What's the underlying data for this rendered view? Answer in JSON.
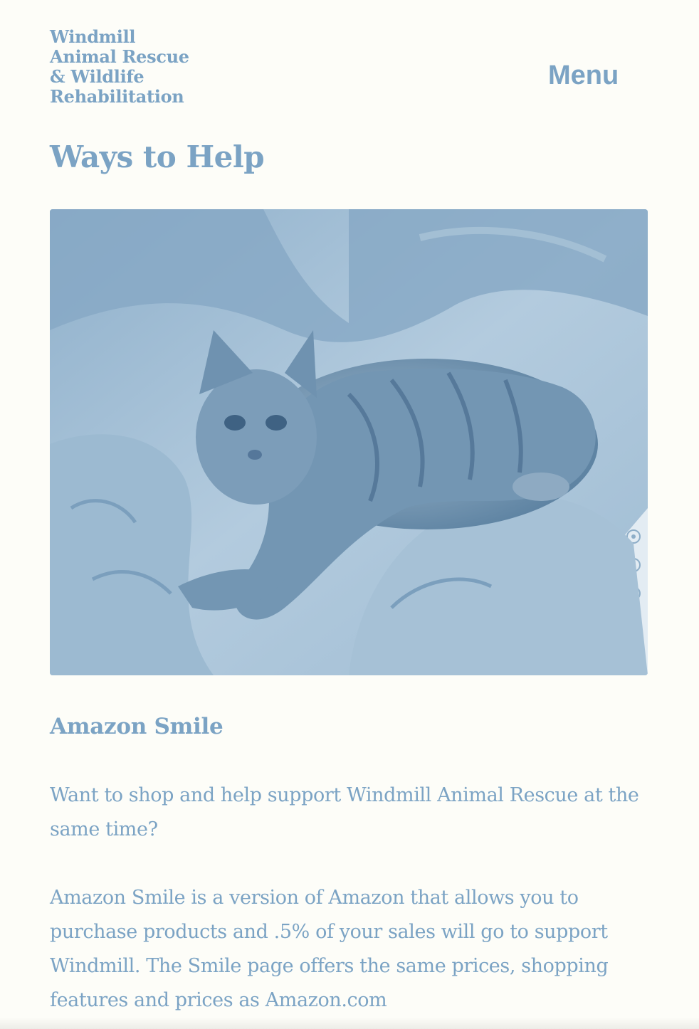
{
  "header": {
    "site_title_lines": [
      "Windmill",
      "Animal Rescue",
      "& Wildlife",
      "Rehabilitation"
    ],
    "menu_label": "Menu"
  },
  "page": {
    "title": "Ways to Help"
  },
  "hero": {
    "image_subject": "kitten-on-blanket"
  },
  "section": {
    "heading": "Amazon Smile",
    "paragraph_1": "Want to shop and help support Windmill Animal Rescue at the same time?",
    "paragraph_2": "Amazon Smile is a version of Amazon that allows you to purchase products and .5% of your sales will go to support Windmill. The Smile page offers the same prices, shopping features and prices as Amazon.com"
  },
  "colors": {
    "background": "#fdfdf8",
    "accent": "#7ba3c4"
  }
}
